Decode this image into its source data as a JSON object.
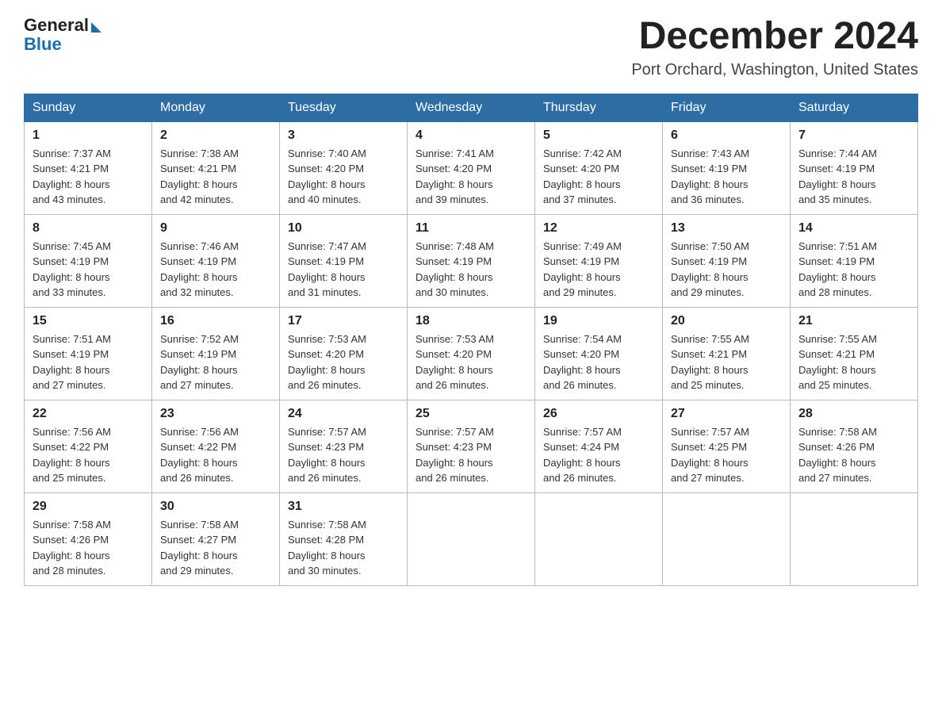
{
  "logo": {
    "general": "General",
    "blue": "Blue"
  },
  "header": {
    "month_year": "December 2024",
    "location": "Port Orchard, Washington, United States"
  },
  "days_of_week": [
    "Sunday",
    "Monday",
    "Tuesday",
    "Wednesday",
    "Thursday",
    "Friday",
    "Saturday"
  ],
  "weeks": [
    [
      {
        "day": "1",
        "sunrise": "7:37 AM",
        "sunset": "4:21 PM",
        "daylight": "8 hours and 43 minutes."
      },
      {
        "day": "2",
        "sunrise": "7:38 AM",
        "sunset": "4:21 PM",
        "daylight": "8 hours and 42 minutes."
      },
      {
        "day": "3",
        "sunrise": "7:40 AM",
        "sunset": "4:20 PM",
        "daylight": "8 hours and 40 minutes."
      },
      {
        "day": "4",
        "sunrise": "7:41 AM",
        "sunset": "4:20 PM",
        "daylight": "8 hours and 39 minutes."
      },
      {
        "day": "5",
        "sunrise": "7:42 AM",
        "sunset": "4:20 PM",
        "daylight": "8 hours and 37 minutes."
      },
      {
        "day": "6",
        "sunrise": "7:43 AM",
        "sunset": "4:19 PM",
        "daylight": "8 hours and 36 minutes."
      },
      {
        "day": "7",
        "sunrise": "7:44 AM",
        "sunset": "4:19 PM",
        "daylight": "8 hours and 35 minutes."
      }
    ],
    [
      {
        "day": "8",
        "sunrise": "7:45 AM",
        "sunset": "4:19 PM",
        "daylight": "8 hours and 33 minutes."
      },
      {
        "day": "9",
        "sunrise": "7:46 AM",
        "sunset": "4:19 PM",
        "daylight": "8 hours and 32 minutes."
      },
      {
        "day": "10",
        "sunrise": "7:47 AM",
        "sunset": "4:19 PM",
        "daylight": "8 hours and 31 minutes."
      },
      {
        "day": "11",
        "sunrise": "7:48 AM",
        "sunset": "4:19 PM",
        "daylight": "8 hours and 30 minutes."
      },
      {
        "day": "12",
        "sunrise": "7:49 AM",
        "sunset": "4:19 PM",
        "daylight": "8 hours and 29 minutes."
      },
      {
        "day": "13",
        "sunrise": "7:50 AM",
        "sunset": "4:19 PM",
        "daylight": "8 hours and 29 minutes."
      },
      {
        "day": "14",
        "sunrise": "7:51 AM",
        "sunset": "4:19 PM",
        "daylight": "8 hours and 28 minutes."
      }
    ],
    [
      {
        "day": "15",
        "sunrise": "7:51 AM",
        "sunset": "4:19 PM",
        "daylight": "8 hours and 27 minutes."
      },
      {
        "day": "16",
        "sunrise": "7:52 AM",
        "sunset": "4:19 PM",
        "daylight": "8 hours and 27 minutes."
      },
      {
        "day": "17",
        "sunrise": "7:53 AM",
        "sunset": "4:20 PM",
        "daylight": "8 hours and 26 minutes."
      },
      {
        "day": "18",
        "sunrise": "7:53 AM",
        "sunset": "4:20 PM",
        "daylight": "8 hours and 26 minutes."
      },
      {
        "day": "19",
        "sunrise": "7:54 AM",
        "sunset": "4:20 PM",
        "daylight": "8 hours and 26 minutes."
      },
      {
        "day": "20",
        "sunrise": "7:55 AM",
        "sunset": "4:21 PM",
        "daylight": "8 hours and 25 minutes."
      },
      {
        "day": "21",
        "sunrise": "7:55 AM",
        "sunset": "4:21 PM",
        "daylight": "8 hours and 25 minutes."
      }
    ],
    [
      {
        "day": "22",
        "sunrise": "7:56 AM",
        "sunset": "4:22 PM",
        "daylight": "8 hours and 25 minutes."
      },
      {
        "day": "23",
        "sunrise": "7:56 AM",
        "sunset": "4:22 PM",
        "daylight": "8 hours and 26 minutes."
      },
      {
        "day": "24",
        "sunrise": "7:57 AM",
        "sunset": "4:23 PM",
        "daylight": "8 hours and 26 minutes."
      },
      {
        "day": "25",
        "sunrise": "7:57 AM",
        "sunset": "4:23 PM",
        "daylight": "8 hours and 26 minutes."
      },
      {
        "day": "26",
        "sunrise": "7:57 AM",
        "sunset": "4:24 PM",
        "daylight": "8 hours and 26 minutes."
      },
      {
        "day": "27",
        "sunrise": "7:57 AM",
        "sunset": "4:25 PM",
        "daylight": "8 hours and 27 minutes."
      },
      {
        "day": "28",
        "sunrise": "7:58 AM",
        "sunset": "4:26 PM",
        "daylight": "8 hours and 27 minutes."
      }
    ],
    [
      {
        "day": "29",
        "sunrise": "7:58 AM",
        "sunset": "4:26 PM",
        "daylight": "8 hours and 28 minutes."
      },
      {
        "day": "30",
        "sunrise": "7:58 AM",
        "sunset": "4:27 PM",
        "daylight": "8 hours and 29 minutes."
      },
      {
        "day": "31",
        "sunrise": "7:58 AM",
        "sunset": "4:28 PM",
        "daylight": "8 hours and 30 minutes."
      },
      null,
      null,
      null,
      null
    ]
  ],
  "labels": {
    "sunrise": "Sunrise:",
    "sunset": "Sunset:",
    "daylight": "Daylight:"
  }
}
